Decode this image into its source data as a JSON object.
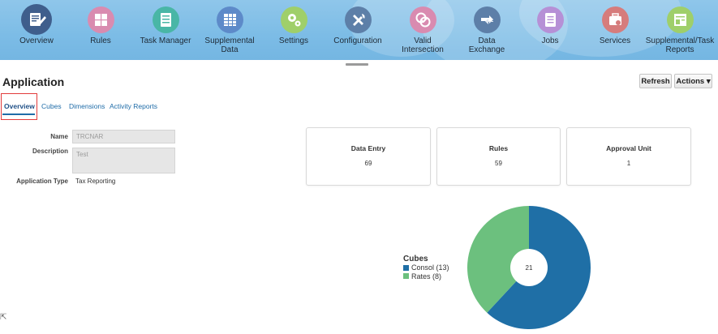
{
  "nav": {
    "items": [
      {
        "label": "Overview",
        "icon": "overview-icon",
        "color": "#3f5e8c"
      },
      {
        "label": "Rules",
        "icon": "rules-icon",
        "color": "#d98bb0"
      },
      {
        "label": "Task Manager",
        "icon": "task-manager-icon",
        "color": "#49b6a6"
      },
      {
        "label": "Supplemental Data",
        "icon": "supplemental-data-icon",
        "color": "#5d8ac9"
      },
      {
        "label": "Settings",
        "icon": "settings-icon",
        "color": "#9fcf6a"
      },
      {
        "label": "Configuration",
        "icon": "configuration-icon",
        "color": "#5d7fa8"
      },
      {
        "label": "Valid Intersection",
        "icon": "valid-intersection-icon",
        "color": "#d98bb0"
      },
      {
        "label": "Data Exchange",
        "icon": "data-exchange-icon",
        "color": "#5d7fa8"
      },
      {
        "label": "Jobs",
        "icon": "jobs-icon",
        "color": "#b690d6"
      },
      {
        "label": "Services",
        "icon": "services-icon",
        "color": "#d67c7c"
      },
      {
        "label": "Supplemental/Task Reports",
        "icon": "supplemental-task-reports-icon",
        "color": "#9fcf6a"
      }
    ]
  },
  "page": {
    "title": "Application",
    "refresh_label": "Refresh",
    "actions_label": "Actions ▾"
  },
  "tabs": [
    "Overview",
    "Cubes",
    "Dimensions",
    "Activity Reports"
  ],
  "details": {
    "name_label": "Name",
    "name_value": "TRCNAR",
    "description_label": "Description",
    "description_value": "Test",
    "type_label": "Application Type",
    "type_value": "Tax Reporting"
  },
  "cards": [
    {
      "title": "Data Entry",
      "value": "69"
    },
    {
      "title": "Rules",
      "value": "59"
    },
    {
      "title": "Approval Unit",
      "value": "1"
    }
  ],
  "chart_data": {
    "type": "pie",
    "title": "Cubes",
    "total_label": "21",
    "series": [
      {
        "name": "Consol (13)",
        "value": 13,
        "color": "#1f6fa6"
      },
      {
        "name": "Rates (8)",
        "value": 8,
        "color": "#6cc07e"
      }
    ]
  }
}
